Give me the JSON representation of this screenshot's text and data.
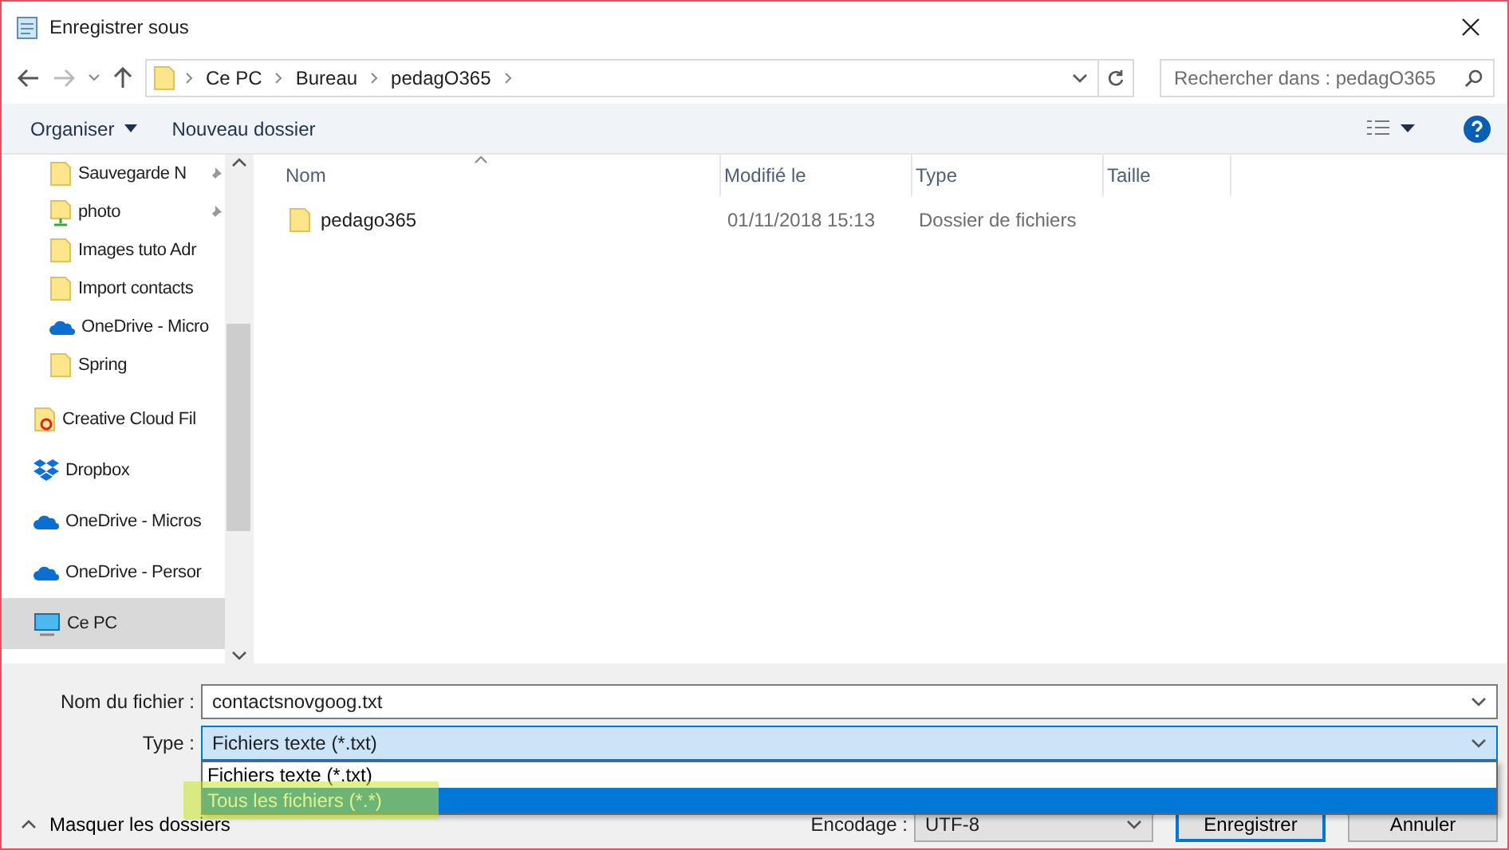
{
  "window": {
    "title": "Enregistrer sous"
  },
  "address": {
    "crumbs": [
      "Ce PC",
      "Bureau",
      "pedagO365"
    ],
    "search_placeholder": "Rechercher dans : pedagO365"
  },
  "toolbar": {
    "organize": "Organiser",
    "new_folder": "Nouveau dossier"
  },
  "sidebar": {
    "quick_access": [
      {
        "label": "Sauvegarde N",
        "kind": "folder",
        "pinned": true,
        "selected": false
      },
      {
        "label": "photo",
        "kind": "network",
        "pinned": true,
        "selected": false
      },
      {
        "label": "Images tuto Adr",
        "kind": "folder",
        "pinned": false,
        "selected": false
      },
      {
        "label": "Import contacts",
        "kind": "folder",
        "pinned": false,
        "selected": false
      },
      {
        "label": "OneDrive - Micro",
        "kind": "cloud",
        "pinned": false,
        "selected": false
      },
      {
        "label": "Spring",
        "kind": "folder",
        "pinned": false,
        "selected": false
      }
    ],
    "locations": [
      {
        "label": "Creative Cloud Fil",
        "kind": "creative",
        "selected": false
      },
      {
        "label": "Dropbox",
        "kind": "dropbox",
        "selected": false
      },
      {
        "label": "OneDrive - Micros",
        "kind": "cloud",
        "selected": false
      },
      {
        "label": "OneDrive - Persor",
        "kind": "cloud",
        "selected": false
      },
      {
        "label": "Ce PC",
        "kind": "pc",
        "selected": true
      }
    ]
  },
  "table": {
    "columns": [
      "Nom",
      "Modifié le",
      "Type",
      "Taille"
    ],
    "rows": [
      {
        "name": "pedago365",
        "modified": "01/11/2018 15:13",
        "type": "Dossier de fichiers"
      }
    ]
  },
  "form": {
    "file_name_label": "Nom du fichier :",
    "file_name": "contactsnovgoog.txt",
    "type_label": "Type :",
    "type_value": "Fichiers texte (*.txt)",
    "type_options": [
      {
        "label": "Fichiers texte (*.txt)",
        "selected": false,
        "highlighted": false
      },
      {
        "label": "Tous les fichiers  (*.*)",
        "selected": true,
        "highlighted": true
      }
    ],
    "encoding_label": "Encodage :",
    "encoding": "UTF-8"
  },
  "footer": {
    "hide_folders": "Masquer les dossiers",
    "save": "Enregistrer",
    "cancel": "Annuler"
  }
}
